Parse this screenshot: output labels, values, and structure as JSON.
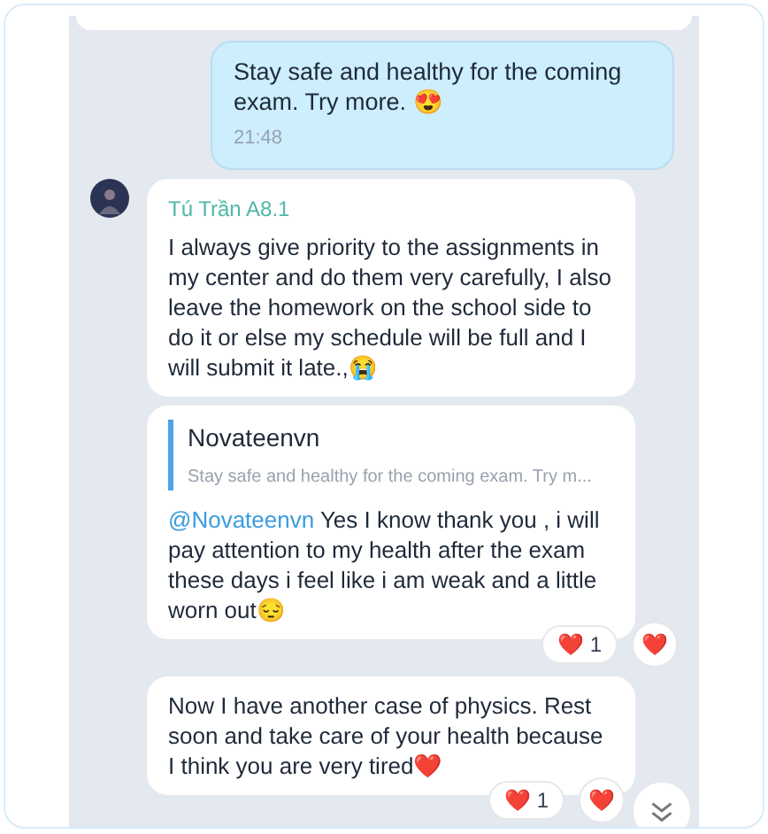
{
  "messages": [
    {
      "kind": "outgoing",
      "text": "Stay safe and healthy for the coming exam. Try more. 😍",
      "time": "21:48"
    },
    {
      "kind": "incoming",
      "sender": "Tú Trần A8.1",
      "text": "I always give priority to the assignments in my center and do them very carefully, I also leave the homework on the school side to do it or else my schedule will be full and I will submit it late.,😭"
    },
    {
      "kind": "reply",
      "quote_author": "Novateenvn",
      "quote_text": "Stay safe and healthy for the coming exam. Try m...",
      "mention": "@Novateenvn",
      "text": " Yes I know thank you , i will pay attention to my health after the exam these days i feel like i am weak and a little worn out😔",
      "reaction": {
        "emoji": "❤️",
        "count": "1"
      },
      "react_button": "❤️"
    },
    {
      "kind": "incoming",
      "text": "Now I have another case of physics. Rest soon and take care of your health because I think you are very tired❤️",
      "reaction": {
        "emoji": "❤️",
        "count": "1"
      },
      "react_button": "❤️"
    }
  ]
}
